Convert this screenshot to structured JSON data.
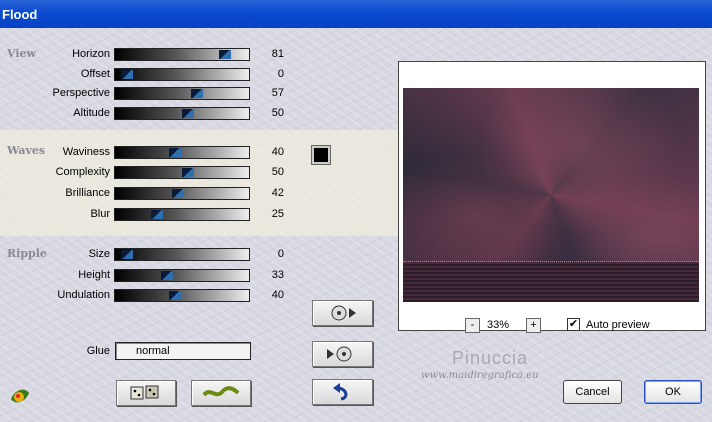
{
  "window": {
    "title": "Flood"
  },
  "sections": {
    "view": "View",
    "waves": "Waves",
    "ripple": "Ripple"
  },
  "sliders": {
    "horizon": {
      "label": "Horizon",
      "value": "81"
    },
    "offset": {
      "label": "Offset",
      "value": "0"
    },
    "perspective": {
      "label": "Perspective",
      "value": "57"
    },
    "altitude": {
      "label": "Altitude",
      "value": "50"
    },
    "waviness": {
      "label": "Waviness",
      "value": "40"
    },
    "complexity": {
      "label": "Complexity",
      "value": "50"
    },
    "brilliance": {
      "label": "Brilliance",
      "value": "42"
    },
    "blur": {
      "label": "Blur",
      "value": "25"
    },
    "size": {
      "label": "Size",
      "value": "0"
    },
    "height": {
      "label": "Height",
      "value": "33"
    },
    "undulation": {
      "label": "Undulation",
      "value": "40"
    }
  },
  "glue": {
    "label": "Glue",
    "value": "normal"
  },
  "zoom": {
    "minus": "-",
    "value": "33%",
    "plus": "+"
  },
  "auto_preview": {
    "label": "Auto preview",
    "checked": true
  },
  "watermark": {
    "name": "Pinuccia",
    "url": "www.maidiregrafica.eu"
  },
  "buttons": {
    "cancel": "Cancel",
    "ok": "OK"
  },
  "colors": {
    "wave_color": "#000000",
    "accent": "#0a4ad0"
  }
}
